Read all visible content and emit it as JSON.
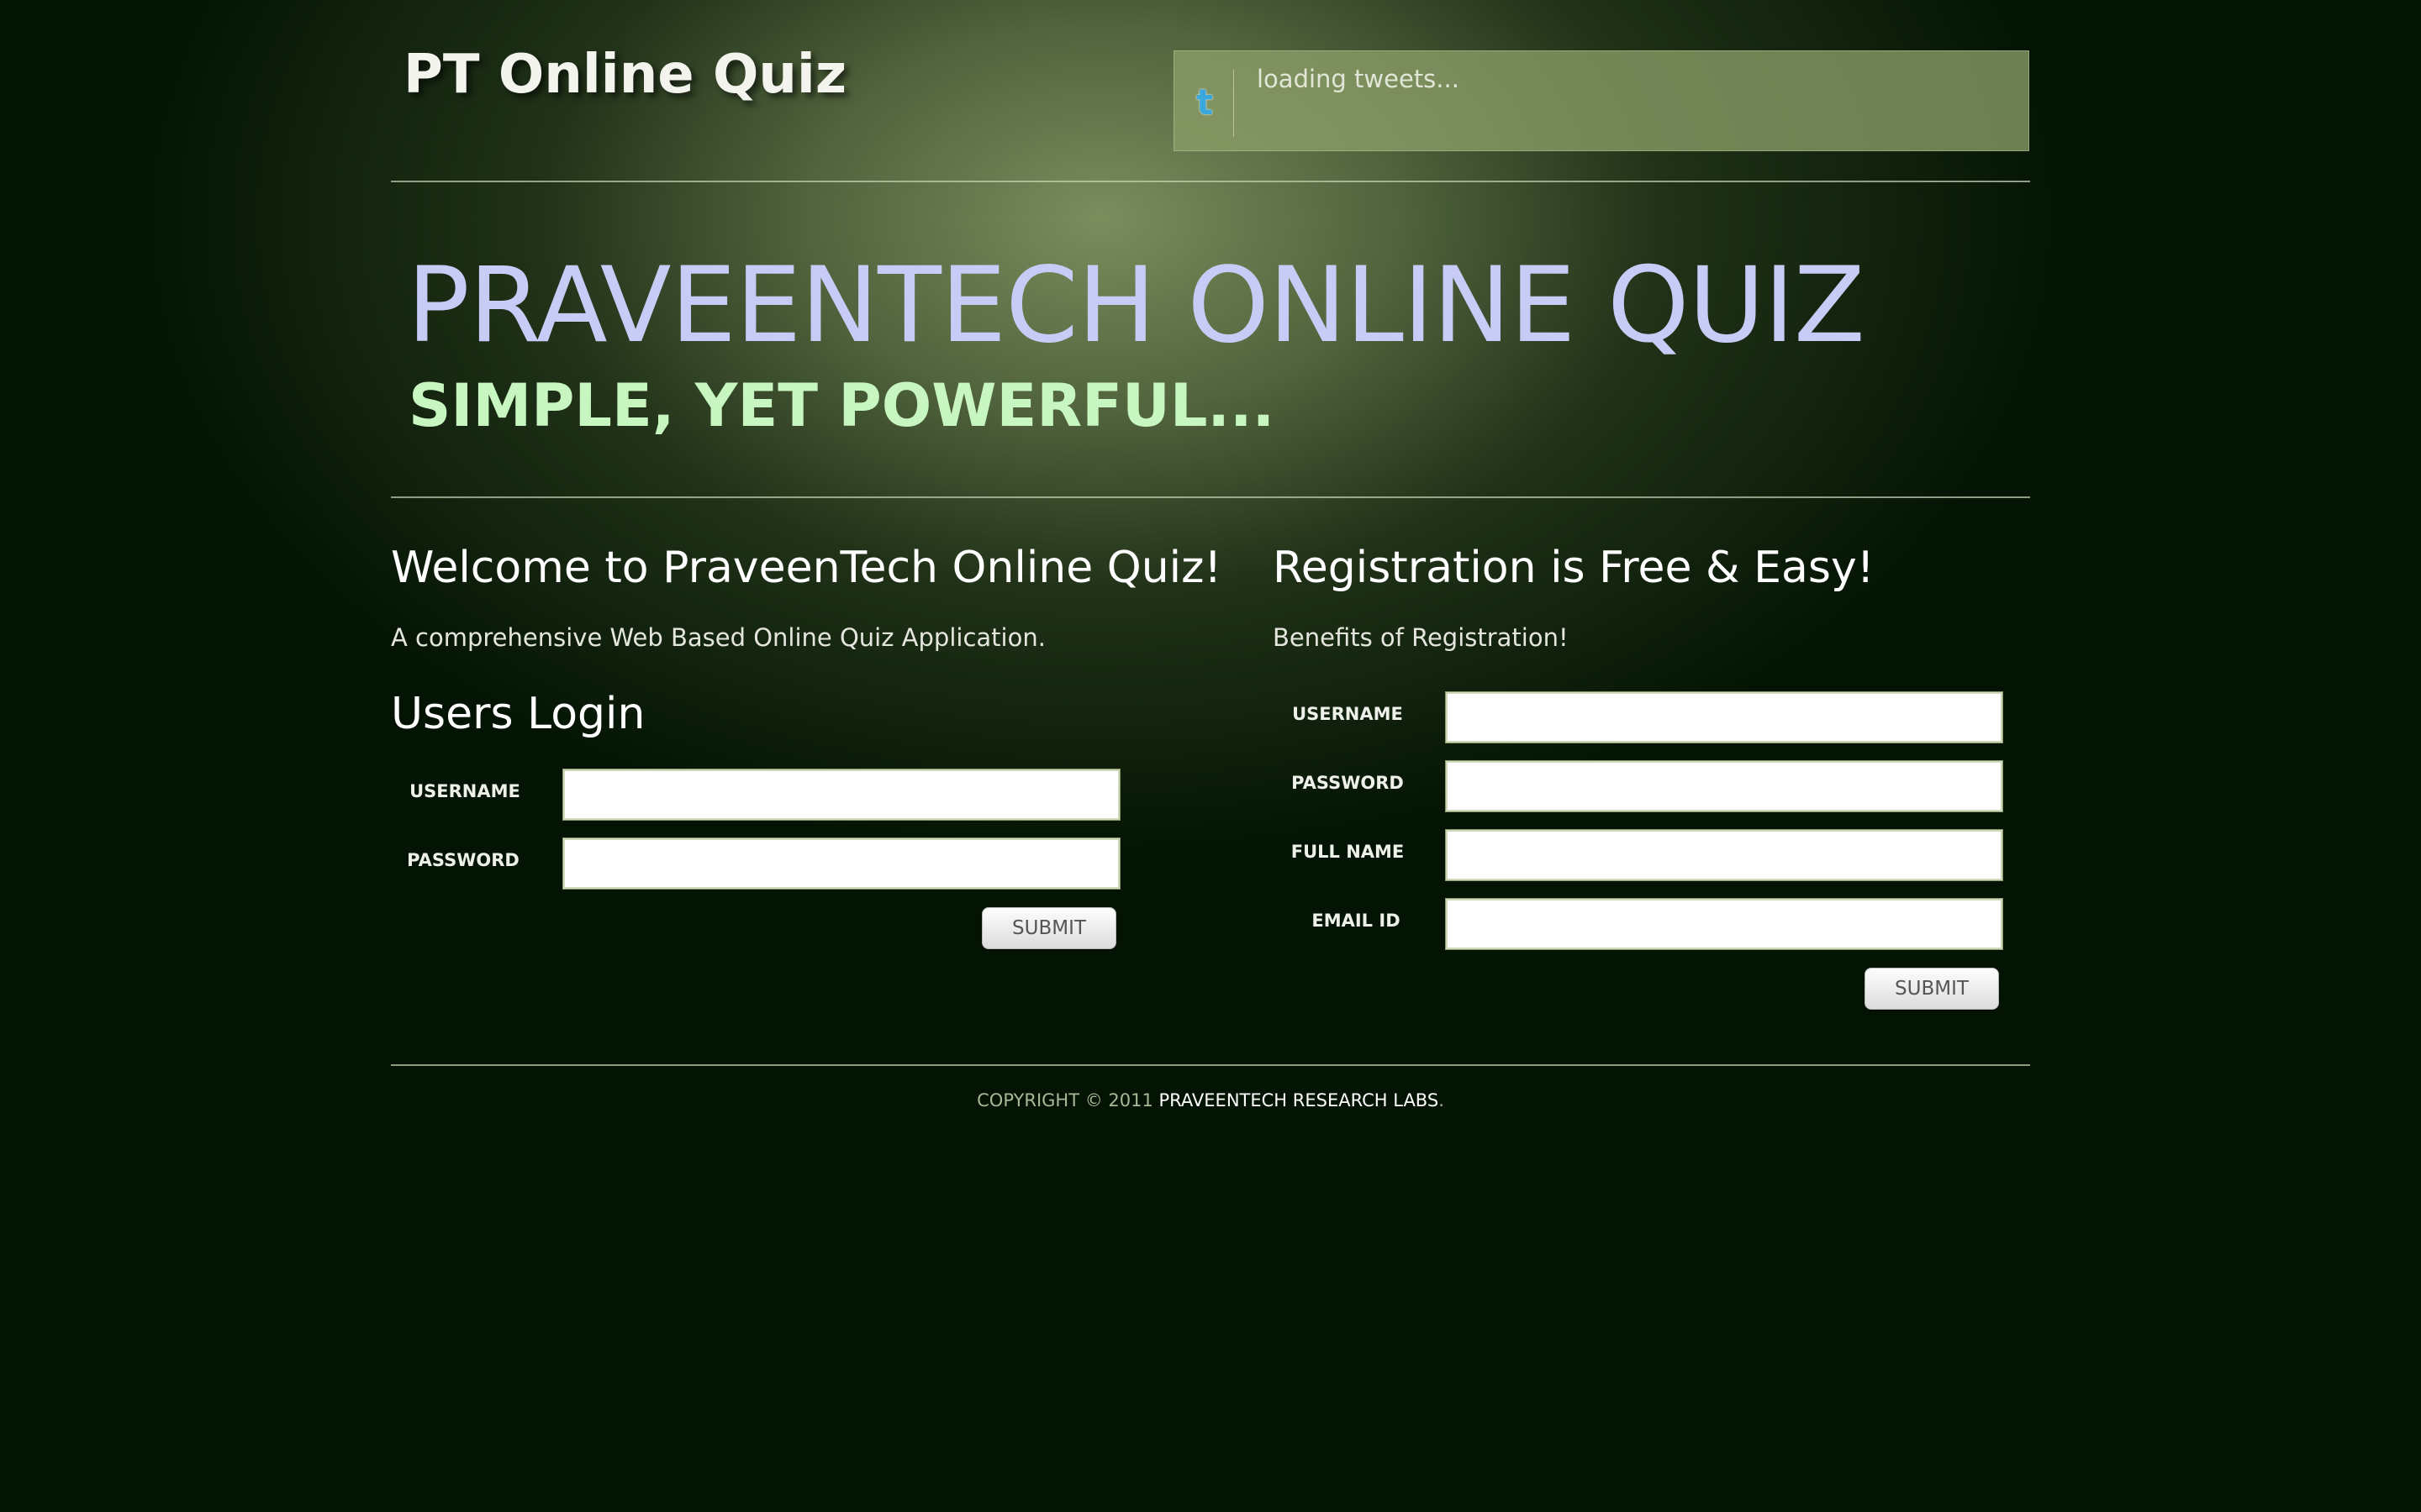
{
  "header": {
    "logo_text": "PT Online Quiz",
    "tweets_text": "loading tweets...",
    "twitter_icon": "twitter-icon"
  },
  "hero": {
    "title": "PRAVEENTECH ONLINE QUIZ",
    "subtitle": "SIMPLE, YET POWERFUL..."
  },
  "welcome": {
    "heading": "Welcome to PraveenTech Online Quiz!",
    "description": "A comprehensive Web Based Online Quiz Application."
  },
  "login": {
    "heading": "Users Login",
    "username_label": "USERNAME",
    "password_label": "PASSWORD",
    "username_value": "",
    "password_value": "",
    "submit_label": "SUBMIT"
  },
  "registration": {
    "heading": "Registration is Free & Easy!",
    "description": "Benefits of Registration!",
    "username_label": "USERNAME",
    "password_label": "PASSWORD",
    "fullname_label": "FULL NAME",
    "email_label": "EMAIL ID",
    "username_value": "",
    "password_value": "",
    "fullname_value": "",
    "email_value": "",
    "submit_label": "SUBMIT"
  },
  "footer": {
    "copyright_text": "COPYRIGHT © 2011 ",
    "company_link": "PRAVEENTECH RESEARCH LABS",
    "trailing": "."
  },
  "colors": {
    "hero_title": "#c8cbf6",
    "hero_subtitle": "#c8f6c0",
    "background_dark": "#041404",
    "twitter_blue": "#3aa8dc"
  }
}
